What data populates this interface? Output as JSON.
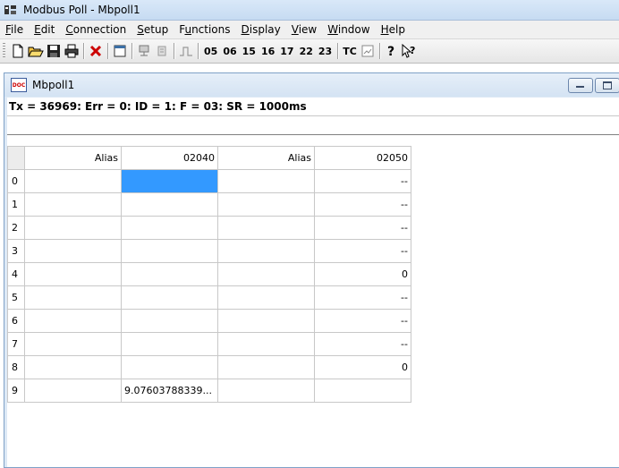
{
  "window": {
    "title": "Modbus Poll - Mbpoll1"
  },
  "menu": [
    {
      "label": "File",
      "ul": "F",
      "rest": "ile"
    },
    {
      "label": "Edit",
      "ul": "E",
      "rest": "dit"
    },
    {
      "label": "Connection",
      "ul": "C",
      "rest": "onnection"
    },
    {
      "label": "Setup",
      "ul": "S",
      "rest": "etup"
    },
    {
      "label": "Functions",
      "ul": "u",
      "pre": "F",
      "rest": "nctions"
    },
    {
      "label": "Display",
      "ul": "D",
      "rest": "isplay"
    },
    {
      "label": "View",
      "ul": "V",
      "rest": "iew"
    },
    {
      "label": "Window",
      "ul": "W",
      "rest": "indow"
    },
    {
      "label": "Help",
      "ul": "H",
      "rest": "elp"
    }
  ],
  "toolbar": {
    "icons": [
      "new-icon",
      "open-icon",
      "save-icon",
      "print-icon",
      "close-icon",
      "window-icon",
      "connect-icon",
      "disconnect-icon",
      "single-poll-icon"
    ],
    "function_codes": [
      "05",
      "06",
      "15",
      "16",
      "17",
      "22",
      "23"
    ],
    "tc_label": "TC"
  },
  "child": {
    "title": "Mbpoll1",
    "status": "Tx = 36969: Err = 0: ID = 1: F = 03: SR = 1000ms"
  },
  "grid": {
    "headers": [
      "Alias",
      "02040",
      "Alias",
      "02050"
    ],
    "rows": [
      {
        "num": "0",
        "c1": "",
        "c2": "",
        "c3": "",
        "c4": "--"
      },
      {
        "num": "1",
        "c1": "",
        "c2": "",
        "c3": "",
        "c4": "--"
      },
      {
        "num": "2",
        "c1": "",
        "c2": "",
        "c3": "",
        "c4": "--"
      },
      {
        "num": "3",
        "c1": "",
        "c2": "",
        "c3": "",
        "c4": "--"
      },
      {
        "num": "4",
        "c1": "",
        "c2": "",
        "c3": "",
        "c4": "0"
      },
      {
        "num": "5",
        "c1": "",
        "c2": "",
        "c3": "",
        "c4": "--"
      },
      {
        "num": "6",
        "c1": "",
        "c2": "",
        "c3": "",
        "c4": "--"
      },
      {
        "num": "7",
        "c1": "",
        "c2": "",
        "c3": "",
        "c4": "--"
      },
      {
        "num": "8",
        "c1": "",
        "c2": "",
        "c3": "",
        "c4": "0"
      },
      {
        "num": "9",
        "c1": "",
        "c2": "9.07603788339...",
        "c3": "",
        "c4": ""
      }
    ],
    "selected_cell": {
      "row": 0,
      "col": 2
    },
    "selection_color": "#3399ff"
  }
}
